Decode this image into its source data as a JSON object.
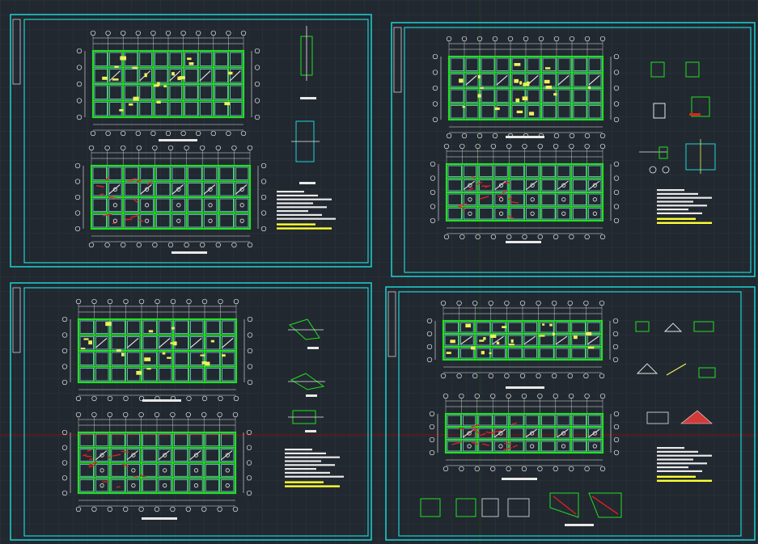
{
  "colors": {
    "background": "#212830",
    "grid": "#2c343d",
    "frame": "#1ed3d3",
    "structure": "#22e022",
    "wall": "#8fe8f4",
    "hatch": "#f0f05a",
    "rebar": "#e02020",
    "ink": "#e9e9e9",
    "highlight": "#ffff33",
    "axis_line": "#c00000"
  },
  "drawing": {
    "sheet_count": 4,
    "sheets": [
      {
        "id": "sheet-1",
        "plans": 2,
        "has_detail_column": true,
        "has_notes": true,
        "notes_lines": 8,
        "highlight_lines": 2
      },
      {
        "id": "sheet-2",
        "plans": 2,
        "has_detail_column": true,
        "has_notes": true,
        "notes_lines": 7,
        "highlight_lines": 2
      },
      {
        "id": "sheet-3",
        "plans": 2,
        "has_detail_column": true,
        "has_notes": true,
        "notes_lines": 8,
        "highlight_lines": 2
      },
      {
        "id": "sheet-4",
        "plans": 2,
        "has_detail_column": true,
        "has_notes": true,
        "notes_lines": 7,
        "highlight_lines": 2
      }
    ]
  }
}
